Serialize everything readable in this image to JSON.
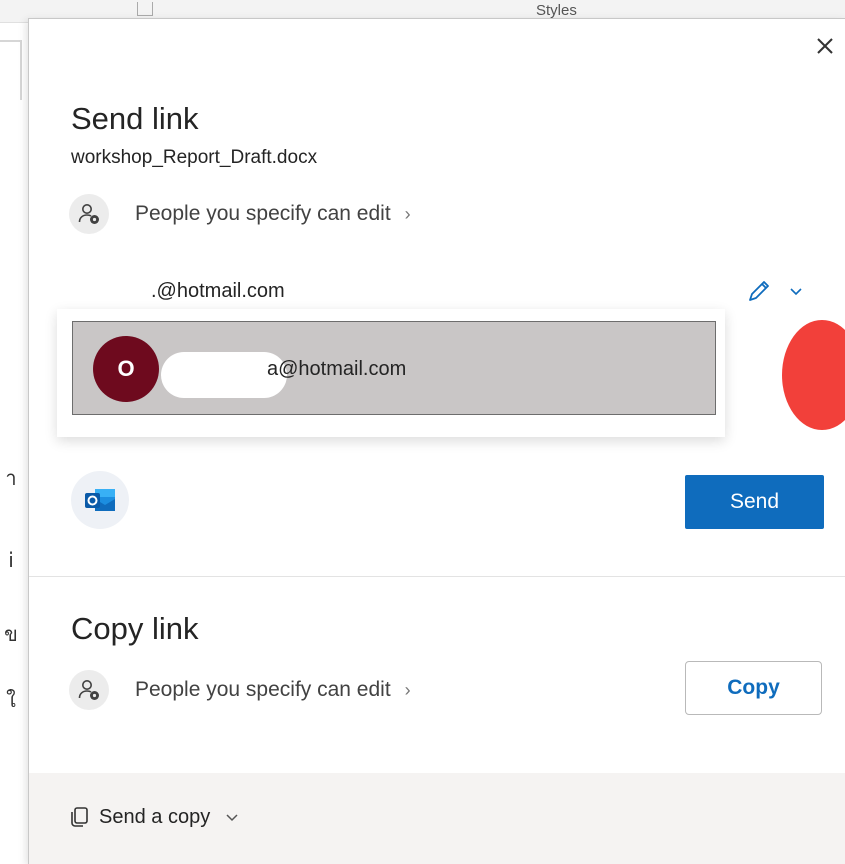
{
  "background": {
    "styles_label": "Styles",
    "left_glyphs": [
      "า",
      "i",
      "ข",
      "ใ"
    ]
  },
  "dialog": {
    "send_link": {
      "title": "Send link",
      "filename": "workshop_Report_Draft.docx",
      "permission_label": "People you specify can edit",
      "email_input_value": ".@hotmail.com",
      "suggestion": {
        "avatar_initial": "O",
        "email_suffix": "a@hotmail.com"
      },
      "send_label": "Send"
    },
    "copy_link": {
      "title": "Copy link",
      "permission_label": "People you specify can edit",
      "copy_label": "Copy"
    },
    "footer": {
      "send_copy_label": "Send a copy"
    }
  },
  "colors": {
    "primary": "#0f6cbd",
    "avatar": "#6e0a1e",
    "suggestion_bg": "#c9c6c6",
    "red_marker": "#f2403a",
    "footer_bg": "#f5f3f2"
  },
  "icons": [
    "close-icon",
    "people-settings-icon",
    "chevron-right-icon",
    "pencil-icon",
    "chevron-down-icon",
    "outlook-icon",
    "copy-icon"
  ]
}
